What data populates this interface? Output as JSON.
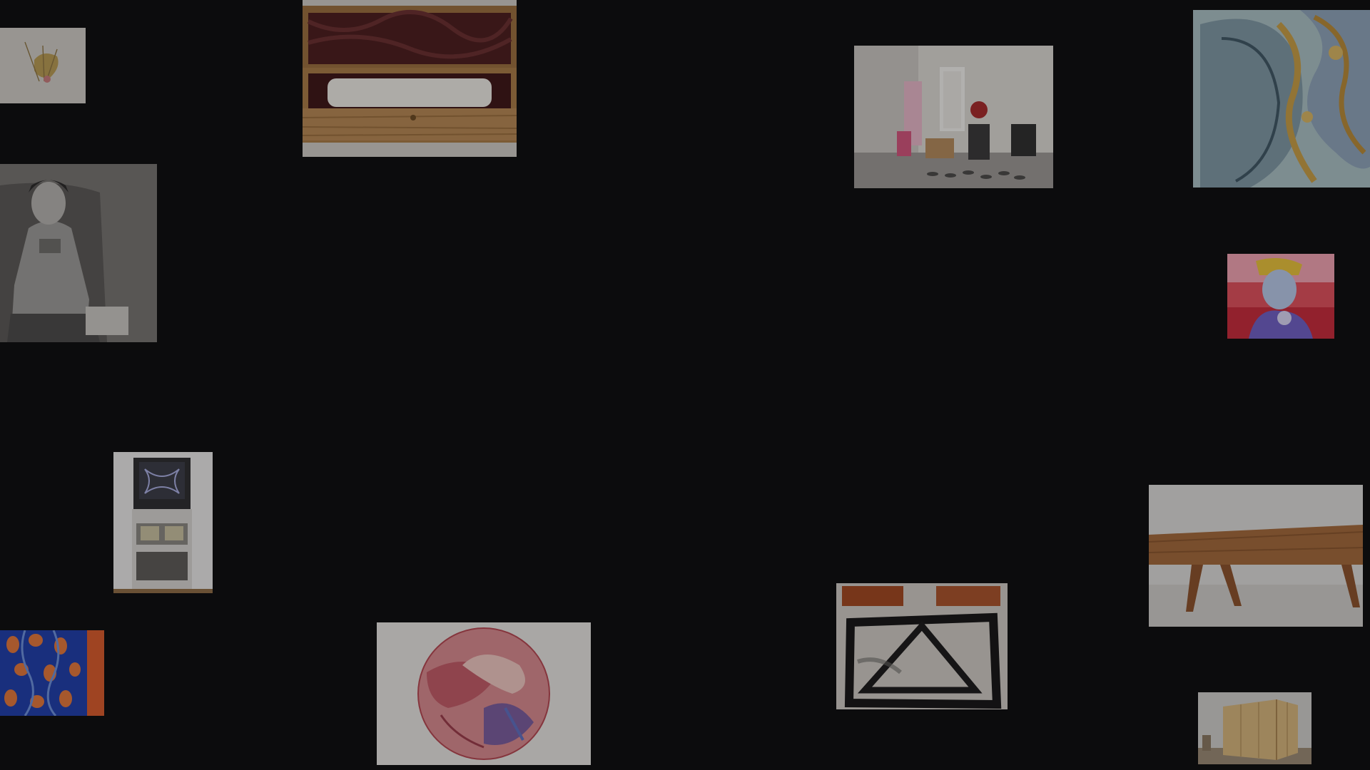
{
  "gallery": {
    "background_color": "#0c0c0d",
    "artworks": [
      {
        "id": "a1",
        "icon": "botanical-drawing-thumbnail"
      },
      {
        "id": "a2",
        "icon": "wooden-box-scroll-thumbnail"
      },
      {
        "id": "a3",
        "icon": "bw-portrait-photo-thumbnail"
      },
      {
        "id": "a4",
        "icon": "cluttered-room-photo-thumbnail"
      },
      {
        "id": "a5",
        "icon": "surreal-painting-thumbnail"
      },
      {
        "id": "a6",
        "icon": "expressionist-portrait-thumbnail"
      },
      {
        "id": "a7",
        "icon": "tv-cabinet-installation-thumbnail"
      },
      {
        "id": "a8",
        "icon": "wooden-bench-thumbnail"
      },
      {
        "id": "a9",
        "icon": "blue-orange-pattern-thumbnail"
      },
      {
        "id": "a10",
        "icon": "circular-line-drawing-thumbnail"
      },
      {
        "id": "a11",
        "icon": "abstract-brush-painting-thumbnail"
      },
      {
        "id": "a12",
        "icon": "wooden-shed-installation-thumbnail"
      }
    ]
  }
}
